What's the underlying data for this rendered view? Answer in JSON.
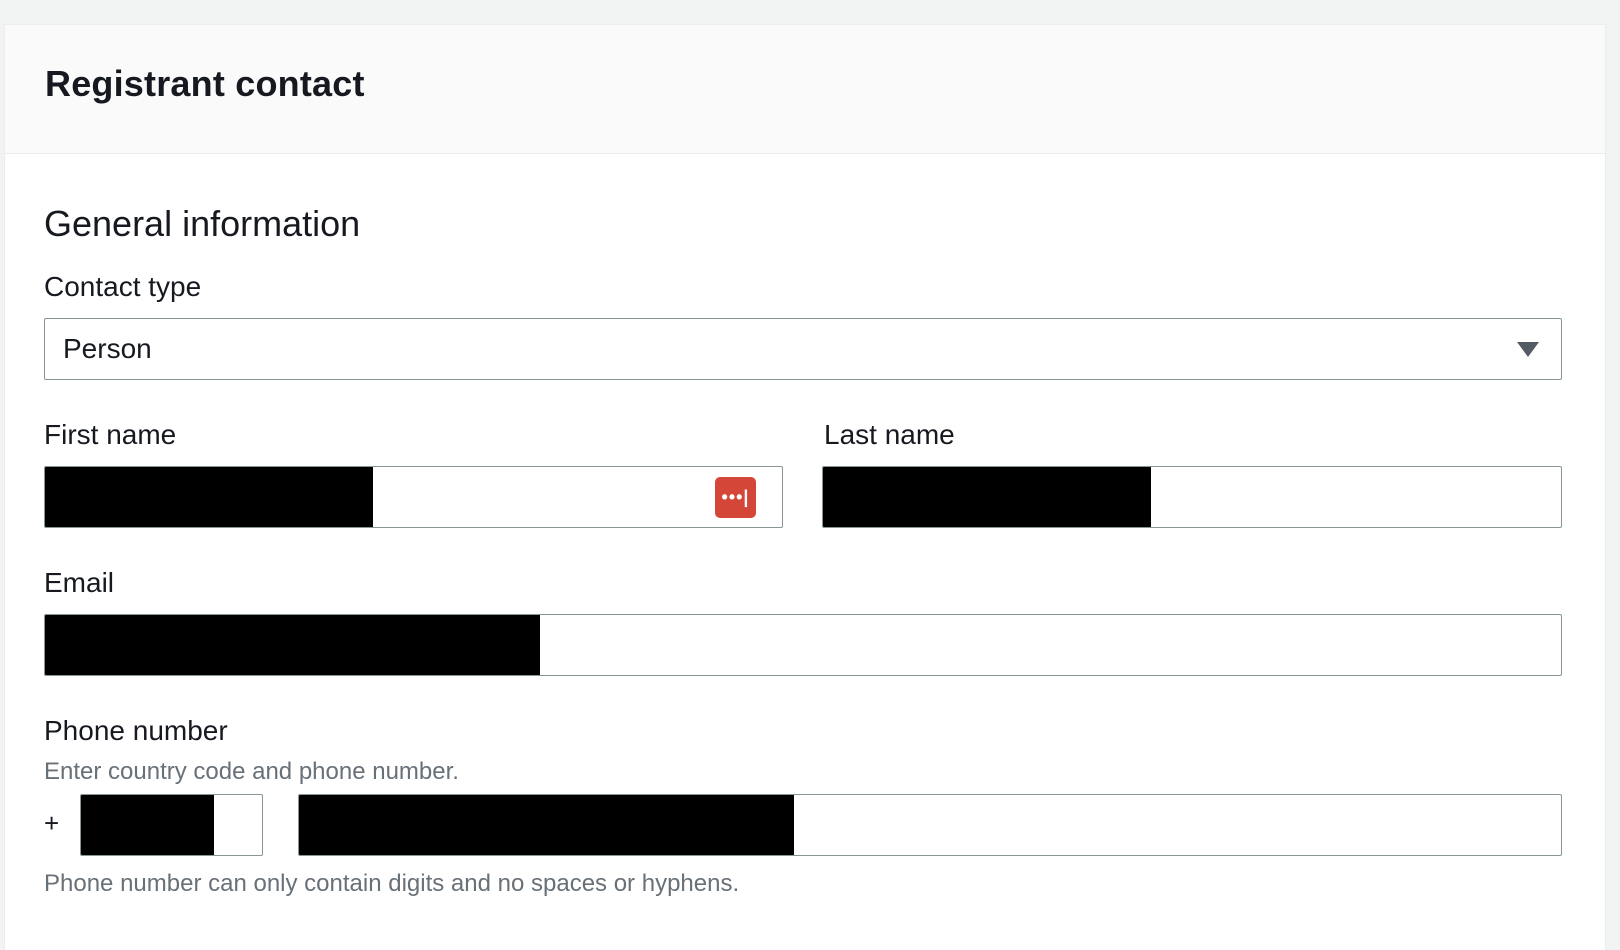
{
  "panel": {
    "title": "Registrant contact"
  },
  "section": {
    "title": "General information"
  },
  "contact_type": {
    "label": "Contact type",
    "value": "Person"
  },
  "first_name": {
    "label": "First name"
  },
  "last_name": {
    "label": "Last name"
  },
  "email": {
    "label": "Email"
  },
  "phone": {
    "label": "Phone number",
    "description": "Enter country code and phone number.",
    "prefix": "+",
    "constraint": "Phone number can only contain digits and no spaces or hyphens."
  },
  "password_manager": {
    "icon": "password-manager-icon",
    "glyph": "•••|",
    "color": "#d44638"
  },
  "redaction_color": "#000000"
}
